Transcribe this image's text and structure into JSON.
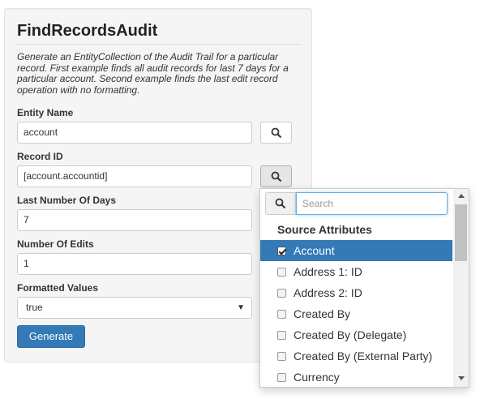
{
  "panel": {
    "title": "FindRecordsAudit",
    "description": "Generate an EntityCollection of the Audit Trail for a particular record. First example finds all audit records for last 7 days for a particular account. Second example finds the last edit record operation with no formatting."
  },
  "fields": {
    "entity_name": {
      "label": "Entity Name",
      "value": "account"
    },
    "record_id": {
      "label": "Record ID",
      "value": "[account.accountid]"
    },
    "last_days": {
      "label": "Last Number Of Days",
      "value": "7"
    },
    "num_edits": {
      "label": "Number Of Edits",
      "value": "1"
    },
    "formatted": {
      "label": "Formatted Values",
      "value": "true"
    }
  },
  "generate_label": "Generate",
  "dropdown": {
    "search_placeholder": "Search",
    "heading": "Source Attributes",
    "items": [
      {
        "label": "Account",
        "checked": true,
        "selected": true
      },
      {
        "label": "Address 1: ID",
        "checked": false,
        "selected": false
      },
      {
        "label": "Address 2: ID",
        "checked": false,
        "selected": false
      },
      {
        "label": "Created By",
        "checked": false,
        "selected": false
      },
      {
        "label": "Created By (Delegate)",
        "checked": false,
        "selected": false
      },
      {
        "label": "Created By (External Party)",
        "checked": false,
        "selected": false
      },
      {
        "label": "Currency",
        "checked": false,
        "selected": false
      }
    ]
  },
  "colors": {
    "primary": "#337ab7",
    "focus": "#66afe9"
  },
  "icons": {
    "lookup": "search-icon",
    "select": "caret-down-icon"
  }
}
